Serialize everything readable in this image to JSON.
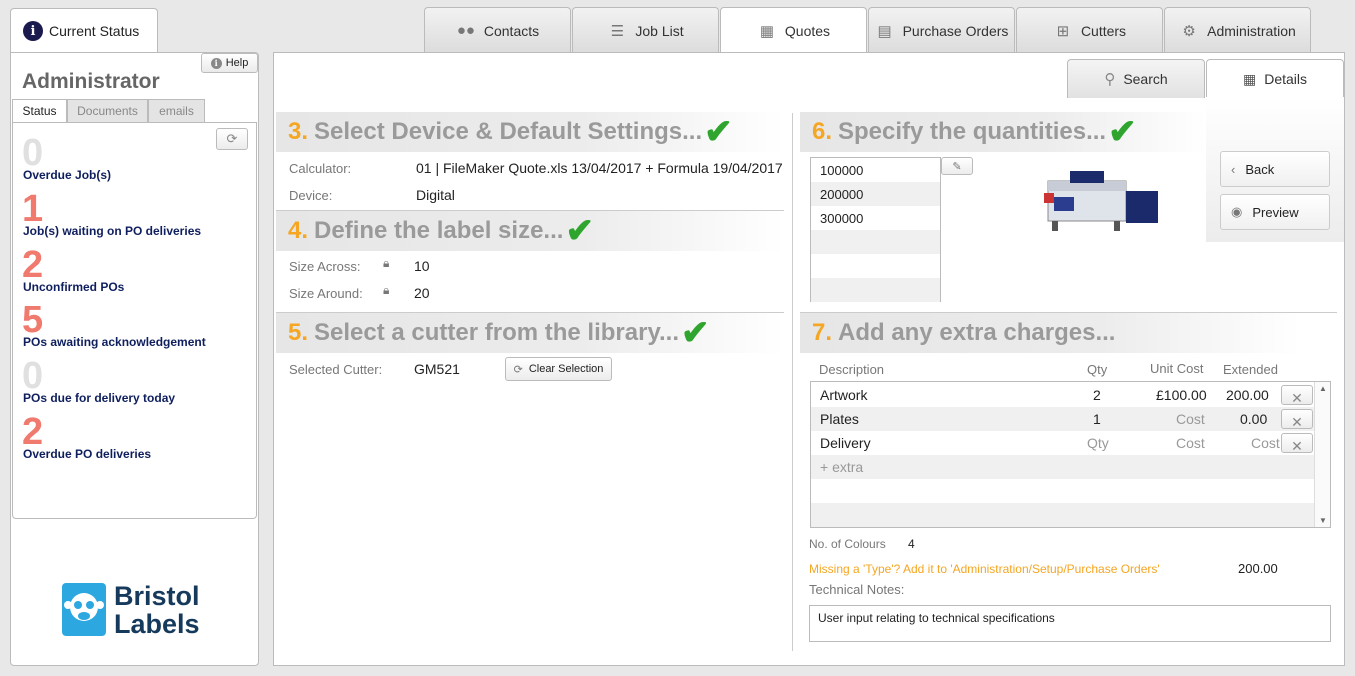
{
  "left": {
    "current_status_tab": "Current Status",
    "help_label": "Help",
    "user_title": "Administrator",
    "subtabs": [
      "Status",
      "Documents",
      "emails"
    ],
    "stats": [
      {
        "count": "0",
        "label": "Overdue Job(s)",
        "color": "#e0e0e0"
      },
      {
        "count": "1",
        "label": "Job(s) waiting on PO deliveries",
        "color": "#f07a6e"
      },
      {
        "count": "2",
        "label": "Unconfirmed POs",
        "color": "#f07a6e"
      },
      {
        "count": "5",
        "label": "POs awaiting acknowledgement",
        "color": "#f07a6e"
      },
      {
        "count": "0",
        "label": "POs due for delivery today",
        "color": "#e0e0e0"
      },
      {
        "count": "2",
        "label": "Overdue PO deliveries",
        "color": "#f07a6e"
      }
    ],
    "logo_line1": "Bristol",
    "logo_line2": "Labels"
  },
  "tabs": [
    "Contacts",
    "Job List",
    "Quotes",
    "Purchase Orders",
    "Cutters",
    "Administration"
  ],
  "subnav": {
    "search": "Search",
    "details": "Details"
  },
  "side_buttons": {
    "back": "Back",
    "preview": "Preview"
  },
  "sections": {
    "s3": {
      "num": "3.",
      "title": "Select Device & Default Settings..."
    },
    "s4": {
      "num": "4.",
      "title": "Define the label size..."
    },
    "s5": {
      "num": "5.",
      "title": "Select a cutter from the library..."
    },
    "s6": {
      "num": "6.",
      "title": "Specify the quantities..."
    },
    "s7": {
      "num": "7.",
      "title": "Add any extra charges..."
    }
  },
  "settings": {
    "calculator_label": "Calculator:",
    "calculator_value": "01 | FileMaker Quote.xls 13/04/2017 + Formula 19/04/2017",
    "device_label": "Device:",
    "device_value": "Digital"
  },
  "size": {
    "across_label": "Size Across:",
    "across_value": "10",
    "around_label": "Size Around:",
    "around_value": "20"
  },
  "cutter": {
    "label": "Selected Cutter:",
    "value": "GM521",
    "clear_button": "Clear Selection"
  },
  "quantities": [
    "100000",
    "200000",
    "300000"
  ],
  "extras": {
    "headers": {
      "description": "Description",
      "qty": "Qty",
      "unit_cost": "Unit Cost",
      "extended": "Extended"
    },
    "rows": [
      {
        "description": "Artwork",
        "qty": "2",
        "unit_cost": "£100.00",
        "extended": "200.00"
      },
      {
        "description": "Plates",
        "qty": "1",
        "unit_cost": "Cost",
        "extended": "0.00"
      },
      {
        "description": "Delivery",
        "qty": "Qty",
        "unit_cost": "Cost",
        "extended": "Cost"
      }
    ],
    "add_placeholder": "+ extra",
    "colours_label": "No. of Colours",
    "colours_value": "4",
    "missing_type_msg": "Missing a 'Type'? Add it to 'Administration/Setup/Purchase Orders'",
    "total": "200.00",
    "tech_notes_label": "Technical Notes:",
    "tech_notes_value": "User input relating to technical specifications"
  }
}
